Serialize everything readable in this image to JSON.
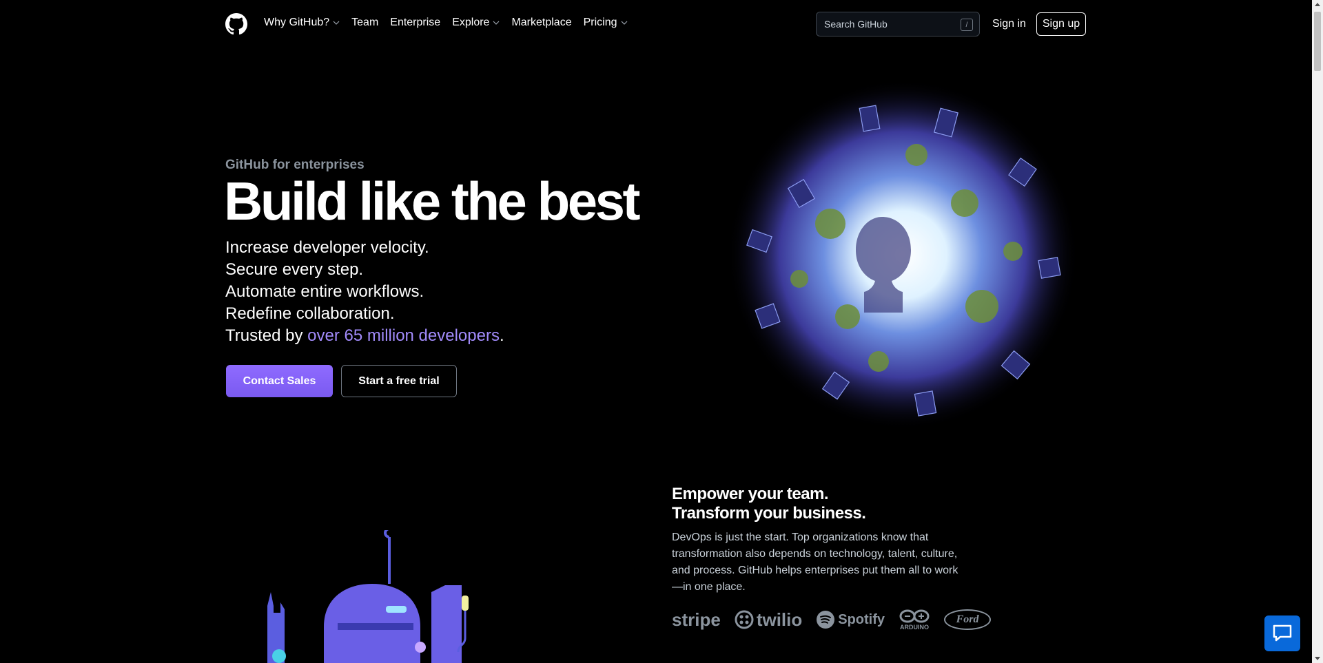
{
  "header": {
    "nav": [
      {
        "label": "Why GitHub?",
        "dropdown": true
      },
      {
        "label": "Team",
        "dropdown": false
      },
      {
        "label": "Enterprise",
        "dropdown": false
      },
      {
        "label": "Explore",
        "dropdown": true
      },
      {
        "label": "Marketplace",
        "dropdown": false
      },
      {
        "label": "Pricing",
        "dropdown": true
      }
    ],
    "search_placeholder": "Search GitHub",
    "search_shortcut": "/",
    "signin": "Sign in",
    "signup": "Sign up"
  },
  "hero": {
    "eyebrow": "GitHub for enterprises",
    "title": "Build like the best",
    "lines": [
      "Increase developer velocity.",
      "Secure every step.",
      "Automate entire workflows.",
      "Redefine collaboration."
    ],
    "trusted_prefix": "Trusted by ",
    "trusted_link": "over 65 million developers",
    "trusted_suffix": ".",
    "primary_cta": "Contact Sales",
    "secondary_cta": "Start a free trial"
  },
  "section2": {
    "title_line1": "Empower your team.",
    "title_line2": "Transform your business.",
    "body": "DevOps is just the start. Top organizations know that transformation also depends on technology, talent, culture, and process. GitHub helps enterprises put them all to work—in one place.",
    "logos": [
      "stripe",
      "twilio",
      "Spotify",
      "ARDUINO",
      "Ford"
    ]
  },
  "colors": {
    "accent": "#8559f5",
    "link": "#a28bfb",
    "chat": "#0969da"
  }
}
